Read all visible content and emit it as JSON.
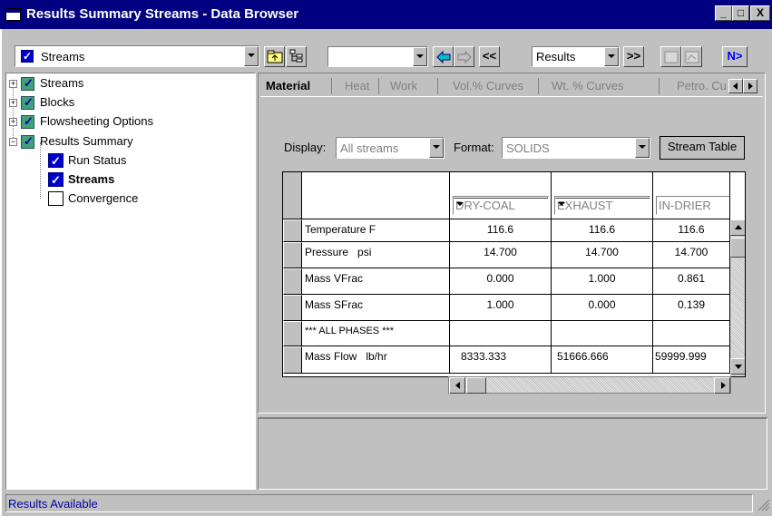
{
  "window": {
    "title": "Results Summary Streams - Data Browser",
    "controls": {
      "minimize": "_",
      "maximize": "□",
      "close": "X"
    }
  },
  "toolbar": {
    "object_combo": "Streams",
    "id_combo": "",
    "prev_label": "<<",
    "next_label": ">>",
    "results_combo": "Results",
    "next_step_label": "N>"
  },
  "tree": {
    "items": [
      {
        "label": "Streams",
        "expander": "+"
      },
      {
        "label": "Blocks",
        "expander": "+"
      },
      {
        "label": "Flowsheeting Options",
        "expander": "+"
      },
      {
        "label": "Results Summary",
        "expander": "−"
      },
      {
        "label": "Run Status"
      },
      {
        "label": "Streams"
      },
      {
        "label": "Convergence"
      }
    ]
  },
  "tabs": [
    "Material",
    "Heat",
    "Work",
    "Vol.% Curves",
    "Wt. % Curves",
    "Petro. Cu"
  ],
  "filters": {
    "display_label": "Display:",
    "display_value": "All streams",
    "format_label": "Format:",
    "format_value": "SOLIDS",
    "stream_table_button": "Stream Table"
  },
  "grid": {
    "columns": [
      "DRY-COAL",
      "EXHAUST",
      "IN-DRIER"
    ],
    "rows": [
      {
        "label": "Temperature F",
        "values": [
          "116.6",
          "116.6",
          "116.6"
        ]
      },
      {
        "label": "Pressure   psi",
        "values": [
          "14.700",
          "14.700",
          "14.700"
        ]
      },
      {
        "label": "Mass VFrac",
        "values": [
          "0.000",
          "1.000",
          "0.861"
        ]
      },
      {
        "label": "Mass SFrac",
        "values": [
          "1.000",
          "0.000",
          "0.139"
        ]
      },
      {
        "label": "*** ALL PHASES ***",
        "values": [
          "",
          "",
          ""
        ]
      },
      {
        "label": "Mass Flow   lb/hr",
        "values": [
          "8333.333",
          "51666.666",
          "59999.999"
        ]
      }
    ]
  },
  "status_bar": {
    "text": "Results Available"
  }
}
